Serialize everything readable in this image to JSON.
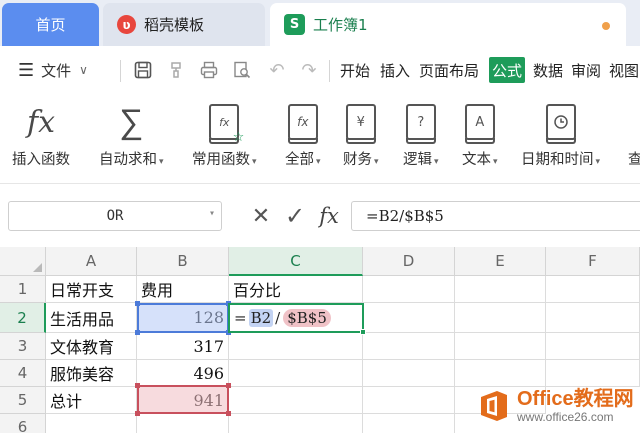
{
  "tabs": {
    "home": "首页",
    "docer": "稻壳模板",
    "workbook": "工作簿1"
  },
  "toolbar": {
    "file_menu": "文件",
    "ribbon_tabs": [
      "开始",
      "插入",
      "页面布局",
      "公式",
      "数据",
      "审阅",
      "视图"
    ],
    "active_tab": "公式"
  },
  "ribbon": {
    "buttons": [
      {
        "label": "插入函数",
        "dropdown": false
      },
      {
        "label": "自动求和",
        "dropdown": true
      },
      {
        "label": "常用函数",
        "dropdown": true
      },
      {
        "label": "全部",
        "dropdown": true
      },
      {
        "label": "财务",
        "dropdown": true
      },
      {
        "label": "逻辑",
        "dropdown": true
      },
      {
        "label": "文本",
        "dropdown": true
      },
      {
        "label": "日期和时间",
        "dropdown": true
      },
      {
        "label": "查",
        "dropdown": false
      }
    ],
    "icon_glyphs": {
      "insert_function": "fx",
      "autosum": "∑",
      "finance": "¥",
      "logic": "?",
      "text": "A"
    }
  },
  "formula_bar": {
    "name_box": "OR",
    "fx_label": "fx",
    "formula": "=B2/$B$5"
  },
  "sheet": {
    "columns": [
      "A",
      "B",
      "C",
      "D",
      "E",
      "F"
    ],
    "rows": [
      "1",
      "2",
      "3",
      "4",
      "5",
      "6"
    ],
    "cells": {
      "A1": "日常开支",
      "B1": "费用",
      "C1": "百分比",
      "A2": "生活用品",
      "B2": "128",
      "A3": "文体教育",
      "B3": "317",
      "A4": "服饰美容",
      "B4": "496",
      "A5": "总计",
      "B5": "941"
    },
    "editing_cell": {
      "eq": "=",
      "ref1": "B2",
      "op": "/",
      "ref2": "$B$5"
    }
  },
  "watermark": {
    "title": "Office教程网",
    "url": "www.office26.com"
  },
  "colors": {
    "accent_green": "#1e9c5a",
    "tab_blue": "#5b8def",
    "ref_blue": "#4c7bd9",
    "ref_red": "#c8505d",
    "watermark_orange": "#e36c1b"
  }
}
